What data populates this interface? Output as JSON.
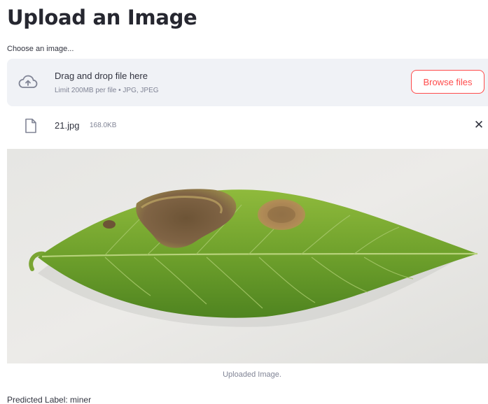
{
  "page": {
    "title": "Upload an Image"
  },
  "uploader": {
    "label": "Choose an image...",
    "drop_title": "Drag and drop file here",
    "limit_text": "Limit 200MB per file • JPG, JPEG",
    "browse_label": "Browse files",
    "upload_icon": "cloud-upload-icon",
    "accent_color": "#ff4b4b",
    "background_color": "#f0f2f6"
  },
  "file": {
    "name": "21.jpg",
    "size": "168.0KB",
    "icon": "file-icon",
    "remove_glyph": "✕"
  },
  "image": {
    "caption": "Uploaded Image."
  },
  "result": {
    "prediction_text": "Predicted Label: miner"
  }
}
